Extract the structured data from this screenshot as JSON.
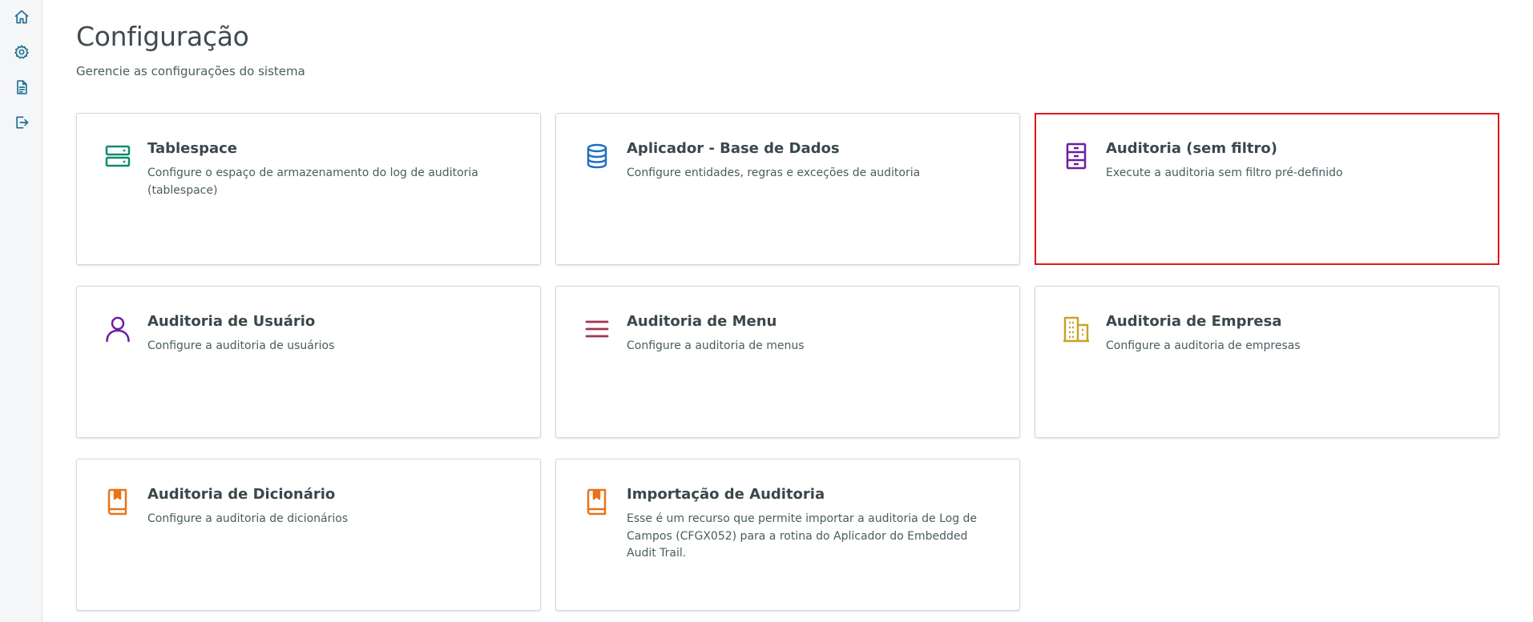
{
  "sidebar": {
    "items": [
      {
        "icon": "home-icon"
      },
      {
        "icon": "gear-icon"
      },
      {
        "icon": "document-icon"
      },
      {
        "icon": "logout-icon"
      }
    ],
    "icon_color": "#1f6f93"
  },
  "header": {
    "title": "Configuração",
    "subtitle": "Gerencie as configurações do sistema"
  },
  "cards": [
    {
      "title": "Tablespace",
      "description": "Configure o espaço de armazenamento do log de auditoria (tablespace)",
      "icon": "server-icon",
      "color": "#0b8a6e"
    },
    {
      "title": "Aplicador - Base de Dados",
      "description": "Configure entidades, regras e exceções de auditoria",
      "icon": "database-icon",
      "color": "#1f6fc2"
    },
    {
      "title": "Auditoria (sem filtro)",
      "description": "Execute a auditoria sem filtro pré-definido",
      "icon": "archive-cabinet-icon",
      "color": "#6c1f9e",
      "selected": true
    },
    {
      "title": "Auditoria de Usuário",
      "description": "Configure a auditoria de usuários",
      "icon": "user-icon",
      "color": "#6c1f9e"
    },
    {
      "title": "Auditoria de Menu",
      "description": "Configure a auditoria de menus",
      "icon": "menu-lines-icon",
      "color": "#a3354c"
    },
    {
      "title": "Auditoria de Empresa",
      "description": "Configure a auditoria de empresas",
      "icon": "building-icon",
      "color": "#c9a227"
    },
    {
      "title": "Auditoria de Dicionário",
      "description": "Configure a auditoria de dicionários",
      "icon": "bookmark-book-icon",
      "color": "#e8731a"
    },
    {
      "title": "Importação de Auditoria",
      "description": "Esse é um recurso que permite importar a auditoria de Log de Campos (CFGX052) para a rotina do Aplicador do Embedded Audit Trail.",
      "icon": "bookmark-book-icon",
      "color": "#e8731a"
    }
  ],
  "colors": {
    "selected_border": "#e0161b"
  }
}
